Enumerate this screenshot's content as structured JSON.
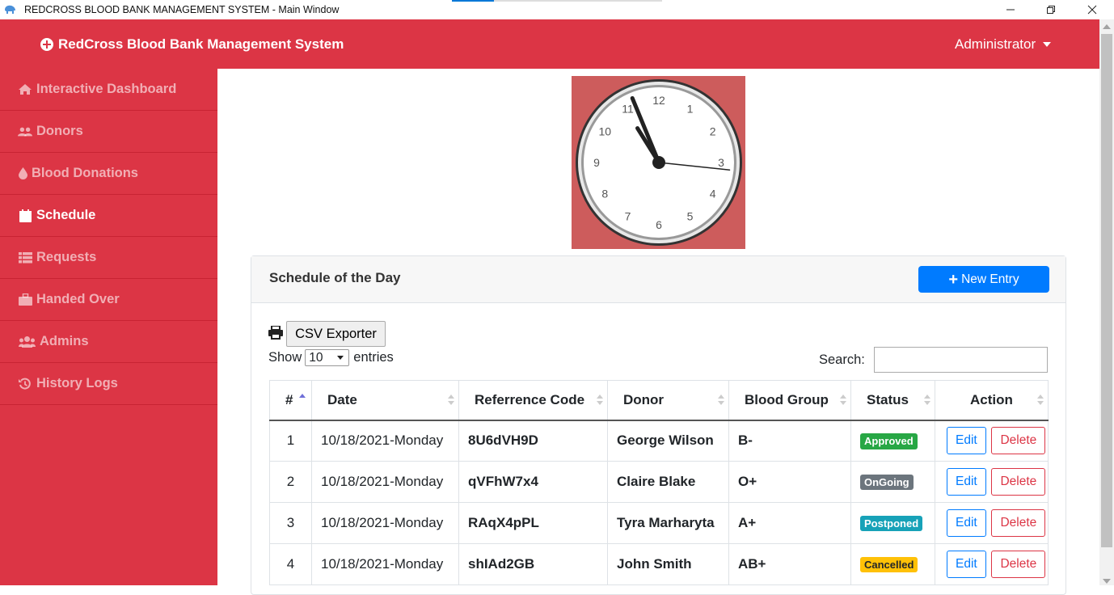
{
  "window": {
    "title": "REDCROSS BLOOD BANK MANAGEMENT SYSTEM - Main Window"
  },
  "header": {
    "brand": "RedCross Blood Bank Management System",
    "user": "Administrator",
    "color": "#dc3545"
  },
  "sidebar": {
    "items": [
      {
        "label": "Interactive Dashboard",
        "icon": "home-icon",
        "active": false
      },
      {
        "label": "Donors",
        "icon": "users-icon",
        "active": false
      },
      {
        "label": "Blood Donations",
        "icon": "droplet-icon",
        "active": false
      },
      {
        "label": "Schedule",
        "icon": "calendar-icon",
        "active": true
      },
      {
        "label": "Requests",
        "icon": "list-icon",
        "active": false
      },
      {
        "label": "Handed Over",
        "icon": "briefcase-icon",
        "active": false
      },
      {
        "label": "Admins",
        "icon": "admins-icon",
        "active": false
      },
      {
        "label": "History Logs",
        "icon": "history-icon",
        "active": false
      }
    ]
  },
  "clock": {
    "numbers": [
      "12",
      "1",
      "2",
      "3",
      "4",
      "5",
      "6",
      "7",
      "8",
      "9",
      "10",
      "11"
    ],
    "time": "10:56:16"
  },
  "card": {
    "title": "Schedule of the Day",
    "new_entry": "New Entry"
  },
  "toolbar": {
    "csv": "CSV Exporter",
    "show": "Show",
    "entries_value": "10",
    "entries": "entries",
    "search": "Search:"
  },
  "table": {
    "headers": [
      "#",
      "Date",
      "Referrence Code",
      "Donor",
      "Blood Group",
      "Status",
      "Action"
    ],
    "edit_label": "Edit",
    "delete_label": "Delete",
    "rows": [
      {
        "num": "1",
        "date": "10/18/2021-Monday",
        "code": "8U6dVH9D",
        "donor": "George Wilson",
        "group": "B-",
        "status": "Approved",
        "status_color": "#28a745"
      },
      {
        "num": "2",
        "date": "10/18/2021-Monday",
        "code": "qVFhW7x4",
        "donor": "Claire Blake",
        "group": "O+",
        "status": "OnGoing",
        "status_color": "#6c757d"
      },
      {
        "num": "3",
        "date": "10/18/2021-Monday",
        "code": "RAqX4pPL",
        "donor": "Tyra Marharyta",
        "group": "A+",
        "status": "Postponed",
        "status_color": "#17a2b8"
      },
      {
        "num": "4",
        "date": "10/18/2021-Monday",
        "code": "shIAd2GB",
        "donor": "John Smith",
        "group": "AB+",
        "status": "Cancelled",
        "status_color": "#ffc107"
      }
    ]
  }
}
